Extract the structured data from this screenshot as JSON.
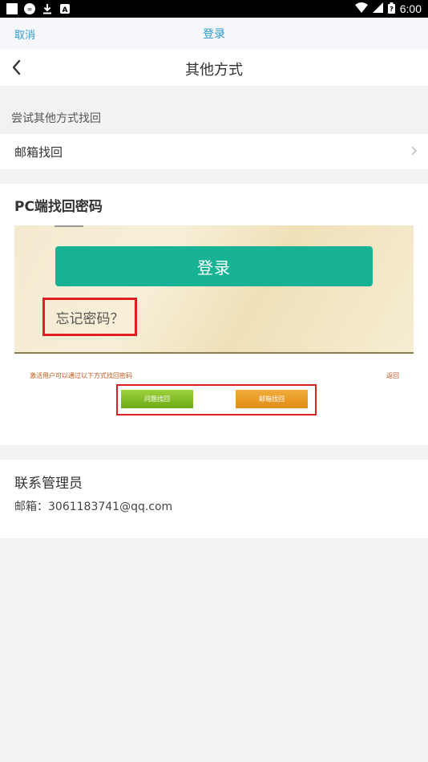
{
  "status_bar": {
    "time": "6:00",
    "icons": [
      "notification-square-icon",
      "infinity-icon",
      "download-icon",
      "a-icon",
      "wifi-icon",
      "signal-icon",
      "battery-icon"
    ]
  },
  "web_bar": {
    "cancel_label": "取消",
    "title": "登录"
  },
  "nav": {
    "title": "其他方式",
    "back_icon": "chevron-left-icon"
  },
  "section": {
    "label": "尝试其他方式找回"
  },
  "email_recovery": {
    "label": "邮箱找回",
    "chevron_icon": "chevron-right-icon"
  },
  "pc_recovery": {
    "title": "PC端找回密码",
    "illustration": {
      "login_button": "登录",
      "forgot_link": "忘记密码？",
      "hint": "激活用户可以通过以下方式找回密码",
      "return_link": "返回",
      "phone_button": "问题找回",
      "email_button": "邮箱找回"
    }
  },
  "admin": {
    "title": "联系管理员",
    "email_line": "邮箱：3061183741@qq.com"
  },
  "colors": {
    "accent_blue": "#2b9bd8",
    "login_green": "#18b394",
    "highlight_red": "#e02020"
  }
}
